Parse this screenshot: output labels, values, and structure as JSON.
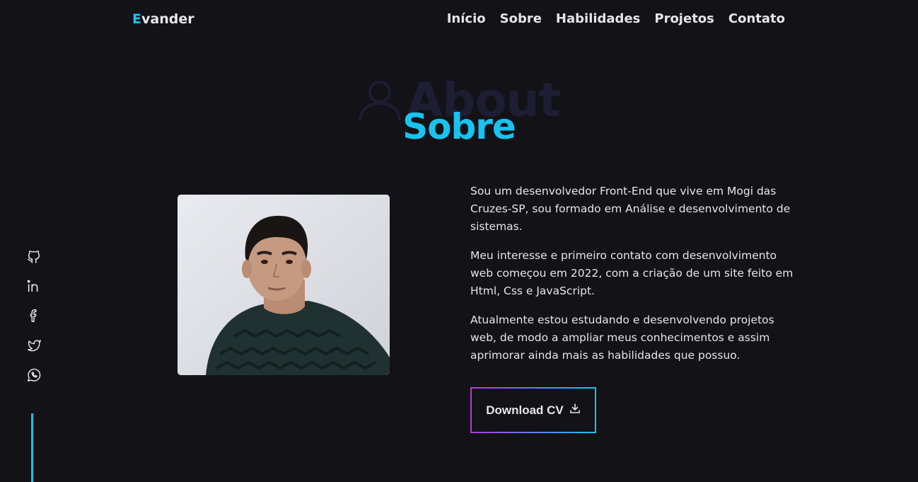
{
  "header": {
    "logo_first": "E",
    "logo_rest": "vander",
    "nav": [
      "Início",
      "Sobre",
      "Habilidades",
      "Projetos",
      "Contato"
    ]
  },
  "section": {
    "bg_title": "About",
    "title": "Sobre"
  },
  "social": [
    "github-icon",
    "linkedin-icon",
    "facebook-icon",
    "twitter-icon",
    "whatsapp-icon"
  ],
  "about": {
    "paragraphs": [
      "Sou um desenvolvedor Front-End que vive em Mogi das Cruzes-SP, sou formado em Análise e desenvolvimento de sistemas.",
      "Meu interesse e primeiro contato com desenvolvimento web começou em 2022, com a criação de um site feito em Html, Css e JavaScript.",
      "Atualmente estou estudando e desenvolvendo projetos web, de modo a ampliar meus conhecimentos e assim aprimorar ainda mais as habilidades que possuo."
    ],
    "cv_button": "Download CV"
  },
  "colors": {
    "background": "#121217",
    "accent": "#18c3f0",
    "bg_title": "#1d1d33",
    "gradient_start": "#b23ad8"
  }
}
